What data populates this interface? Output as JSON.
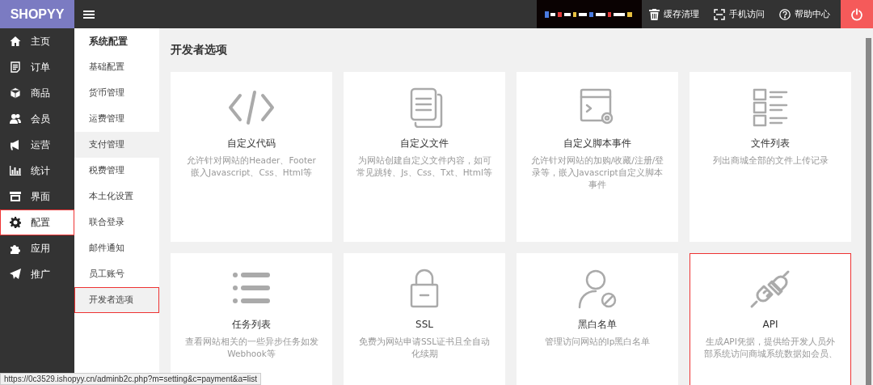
{
  "logo": "SHOPYY",
  "top_actions": [
    {
      "kind": "trash",
      "label": "缓存清理"
    },
    {
      "kind": "scan",
      "label": "手机访问"
    },
    {
      "kind": "help",
      "label": "帮助中心"
    }
  ],
  "nav": [
    {
      "label": "主页",
      "selected": false
    },
    {
      "label": "订单",
      "selected": false
    },
    {
      "label": "商品",
      "selected": false
    },
    {
      "label": "会员",
      "selected": false
    },
    {
      "label": "运营",
      "selected": false
    },
    {
      "label": "统计",
      "selected": false
    },
    {
      "label": "界面",
      "selected": false
    },
    {
      "label": "配置",
      "selected": true
    },
    {
      "label": "应用",
      "selected": false
    },
    {
      "label": "推广",
      "selected": false
    }
  ],
  "submenu": {
    "title": "系统配置",
    "items": [
      {
        "label": "基础配置",
        "selected": false,
        "hovered": false
      },
      {
        "label": "货币管理",
        "selected": false,
        "hovered": false
      },
      {
        "label": "运费管理",
        "selected": false,
        "hovered": false
      },
      {
        "label": "支付管理",
        "selected": false,
        "hovered": true
      },
      {
        "label": "税费管理",
        "selected": false,
        "hovered": false
      },
      {
        "label": "本土化设置",
        "selected": false,
        "hovered": false
      },
      {
        "label": "联合登录",
        "selected": false,
        "hovered": false
      },
      {
        "label": "邮件通知",
        "selected": false,
        "hovered": false
      },
      {
        "label": "员工账号",
        "selected": false,
        "hovered": false
      },
      {
        "label": "开发者选项",
        "selected": true,
        "hovered": false
      }
    ]
  },
  "page_title": "开发者选项",
  "cards": [
    {
      "title": "自定义代码",
      "description": [
        "允许针对网站的Header、Footer",
        "嵌入Javascript、Css、Html等"
      ],
      "highlighted": false
    },
    {
      "title": "自定义文件",
      "description": [
        "为网站创建自定义文件内容，如可",
        "常见跳转、Js、Css、Txt、Html等"
      ],
      "highlighted": false
    },
    {
      "title": "自定义脚本事件",
      "description": [
        "允许针对网站的加购/收藏/注册/登",
        "录等，嵌入Javascript自定义脚本",
        "事件"
      ],
      "highlighted": false
    },
    {
      "title": "文件列表",
      "description": [
        "列出商城全部的文件上传记录"
      ],
      "highlighted": false
    },
    {
      "title": "任务列表",
      "description": [
        "查看网站相关的一些异步任务如发",
        "Webhook等"
      ],
      "highlighted": false
    },
    {
      "title": "SSL",
      "description": [
        "免费为网站申请SSL证书且全自动",
        "化续期"
      ],
      "highlighted": false
    },
    {
      "title": "黑白名单",
      "description": [
        "管理访问网站的Ip黑白名单"
      ],
      "highlighted": false
    },
    {
      "title": "API",
      "description": [
        "生成API凭据，提供给开发人员外",
        "部系统访问商城系统数据如会员、"
      ],
      "highlighted": true
    }
  ],
  "status_url": "https://0c3529.ishopyy.cn/adminb2c.php?m=setting&c=payment&a=list"
}
